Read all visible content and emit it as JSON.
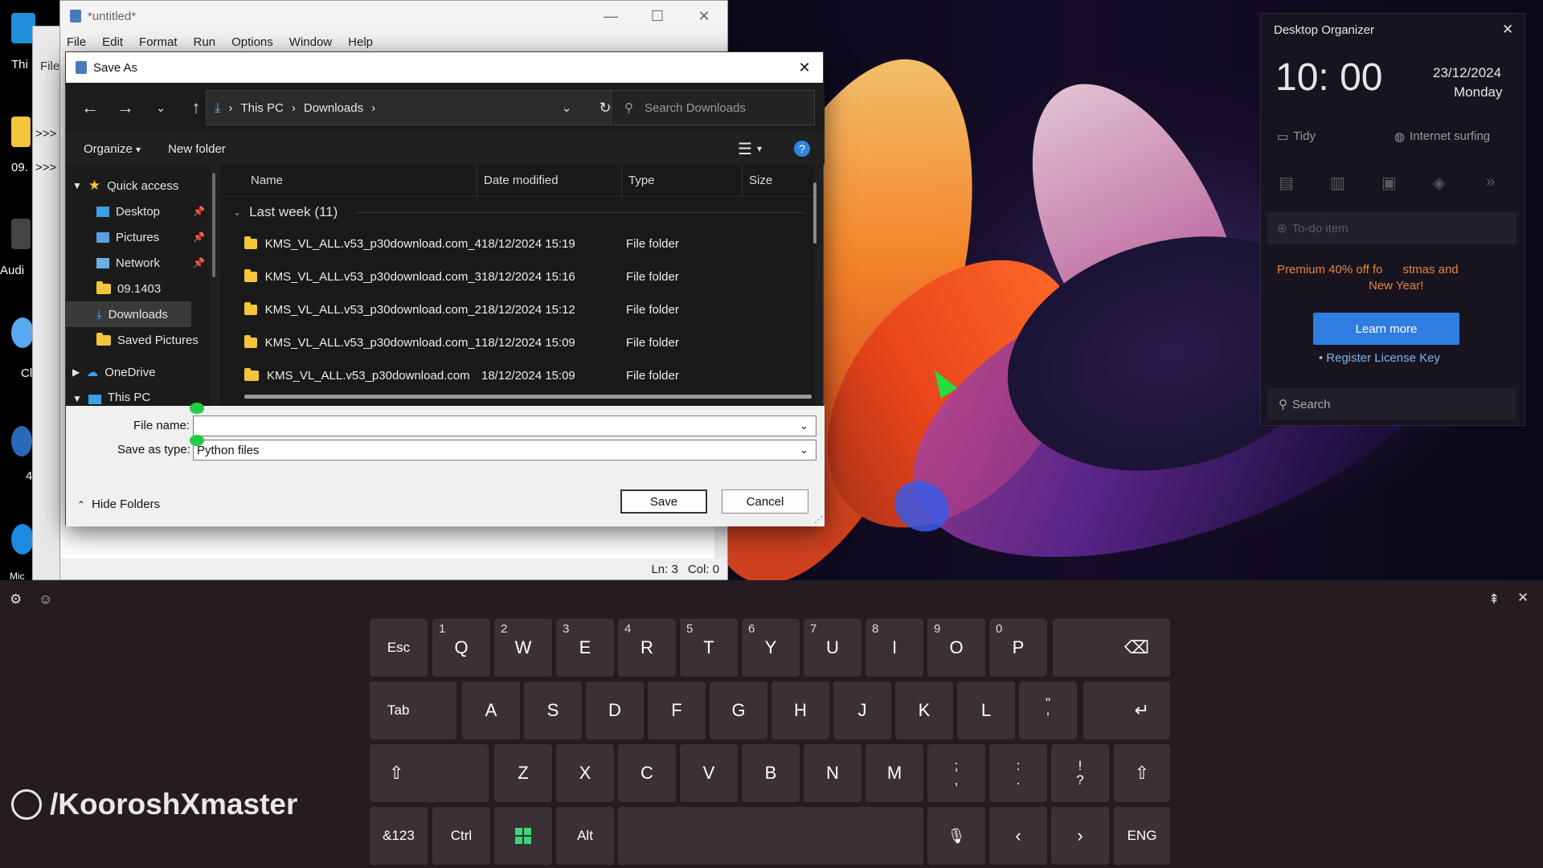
{
  "desktop": {
    "labels": [
      "Thi",
      "09.",
      "Audi",
      "Cl",
      "4",
      "Mic"
    ],
    "arrows": [
      ">>>",
      ">>>"
    ]
  },
  "notepad": {
    "title": "*untitled*",
    "menu": [
      "File",
      "Edit",
      "Format",
      "Run",
      "Options",
      "Window",
      "Help"
    ],
    "back_label": "File",
    "status_ln": "Ln: 3",
    "status_col": "Col: 0"
  },
  "dialog": {
    "title": "Save As",
    "close": "✕",
    "address": {
      "this_pc": "This PC",
      "downloads": "Downloads"
    },
    "search_placeholder": "Search Downloads",
    "toolbar": {
      "organize": "Organize",
      "new_folder": "New folder"
    },
    "nav": {
      "quick_access": "Quick access",
      "items": [
        "Desktop",
        "Pictures",
        "Network",
        "09.1403",
        "Downloads",
        "Saved Pictures"
      ],
      "onedrive": "OneDrive",
      "this_pc": "This PC"
    },
    "columns": {
      "name": "Name",
      "date": "Date modified",
      "type": "Type",
      "size": "Size"
    },
    "group": "Last week (11)",
    "files": [
      {
        "name": "KMS_VL_ALL.v53_p30download.com_4",
        "date": "18/12/2024 15:19",
        "type": "File folder"
      },
      {
        "name": "KMS_VL_ALL.v53_p30download.com_3",
        "date": "18/12/2024 15:16",
        "type": "File folder"
      },
      {
        "name": "KMS_VL_ALL.v53_p30download.com_2",
        "date": "18/12/2024 15:12",
        "type": "File folder"
      },
      {
        "name": "KMS_VL_ALL.v53_p30download.com_1",
        "date": "18/12/2024 15:09",
        "type": "File folder"
      },
      {
        "name": "KMS_VL_ALL.v53_p30download.com",
        "date": "18/12/2024 15:09",
        "type": "File folder"
      }
    ],
    "file_name_label": "File name:",
    "file_name_value": "",
    "save_type_label": "Save as type:",
    "save_type_value": "Python files",
    "hide_folders": "Hide Folders",
    "save": "Save",
    "cancel": "Cancel"
  },
  "organizer": {
    "title": "Desktop Organizer",
    "time": "10: 00",
    "date": "23/12/2024",
    "weekday": "Monday",
    "tidy": "Tidy",
    "internet": "Internet surfing",
    "todo": "To-do item",
    "promo": "Premium 40% off fo      stmas and",
    "promo2": "New Year!",
    "learn_more": "Learn more",
    "register": "Register License Key",
    "search": "Search"
  },
  "keyboard": {
    "row1": [
      {
        "k": "Esc"
      },
      {
        "k": "Q",
        "n": "1"
      },
      {
        "k": "W",
        "n": "2"
      },
      {
        "k": "E",
        "n": "3"
      },
      {
        "k": "R",
        "n": "4"
      },
      {
        "k": "T",
        "n": "5"
      },
      {
        "k": "Y",
        "n": "6"
      },
      {
        "k": "U",
        "n": "7"
      },
      {
        "k": "I",
        "n": "8"
      },
      {
        "k": "O",
        "n": "9"
      },
      {
        "k": "P",
        "n": "0"
      }
    ],
    "row2": [
      "Tab",
      "A",
      "S",
      "D",
      "F",
      "G",
      "H",
      "J",
      "K",
      "L"
    ],
    "row3": [
      "Z",
      "X",
      "C",
      "V",
      "B",
      "N",
      "M"
    ],
    "row4": {
      "sym": "&123",
      "ctrl": "Ctrl",
      "alt": "Alt",
      "lang": "ENG"
    },
    "quote_top": "\"",
    "quote_bot": "'",
    "semi_top": ";",
    "semi_bot": ",",
    "colon_top": ":",
    "colon_bot": ".",
    "excl_top": "!",
    "excl_bot": "?"
  },
  "watermark": "/KooroshXmaster",
  "colors": {
    "accent": "#2f7de1",
    "promo": "#e8833a",
    "register": "#7ab6f0"
  }
}
